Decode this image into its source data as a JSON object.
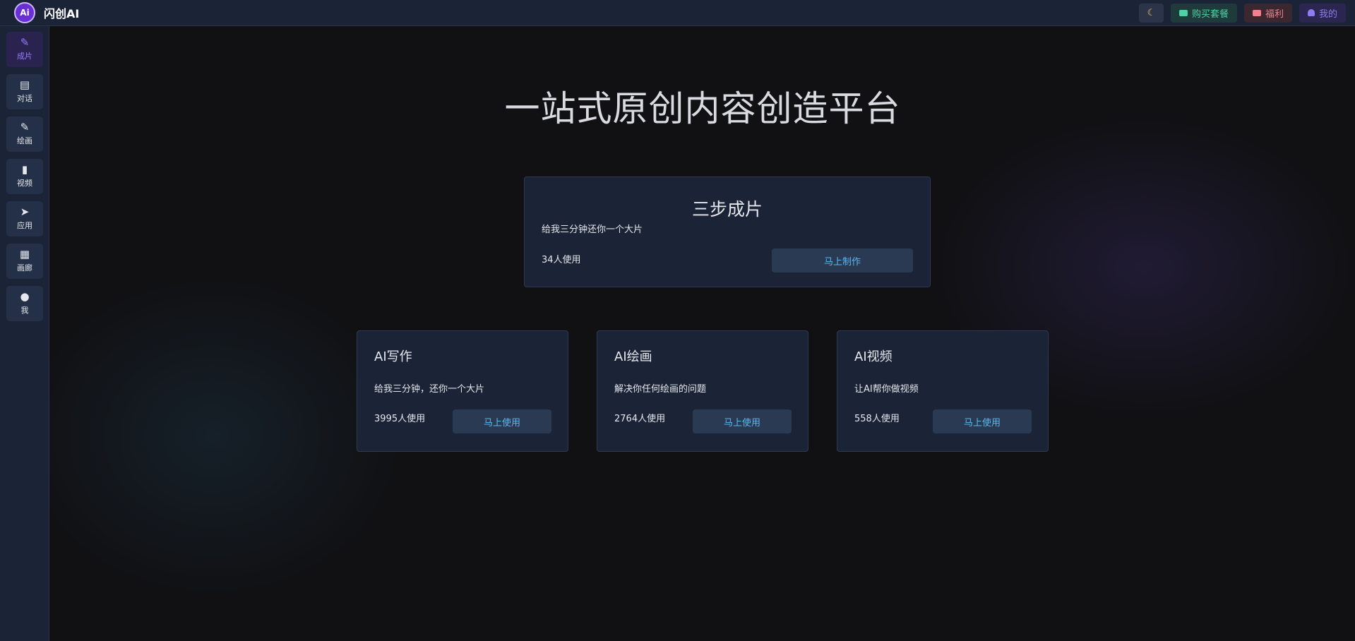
{
  "app": {
    "logo_text": "Ai",
    "name": "闪创AI"
  },
  "topbar": {
    "theme_icon": "moon-icon",
    "buy_label": "购买套餐",
    "welfare_label": "福利",
    "mine_label": "我的"
  },
  "sidebar": {
    "items": [
      {
        "label": "成片",
        "icon": "edit-icon",
        "active": true
      },
      {
        "label": "对话",
        "icon": "chat-icon",
        "active": false
      },
      {
        "label": "绘画",
        "icon": "brush-icon",
        "active": false
      },
      {
        "label": "视频",
        "icon": "phone-icon",
        "active": false
      },
      {
        "label": "应用",
        "icon": "rocket-icon",
        "active": false
      },
      {
        "label": "画廊",
        "icon": "gallery-icon",
        "active": false
      },
      {
        "label": "我",
        "icon": "user-icon",
        "active": false
      }
    ]
  },
  "main": {
    "title": "一站式原创内容创造平台",
    "feature": {
      "title": "三步成片",
      "desc": "给我三分钟还你一个大片",
      "count": "34人使用",
      "button": "马上制作"
    },
    "cards": [
      {
        "title": "AI写作",
        "desc": "给我三分钟，还你一个大片",
        "count": "3995人使用",
        "button": "马上使用"
      },
      {
        "title": "AI绘画",
        "desc": "解决你任何绘画的问题",
        "count": "2764人使用",
        "button": "马上使用"
      },
      {
        "title": "AI视频",
        "desc": "让AI帮你做视频",
        "count": "558人使用",
        "button": "马上使用"
      }
    ]
  }
}
